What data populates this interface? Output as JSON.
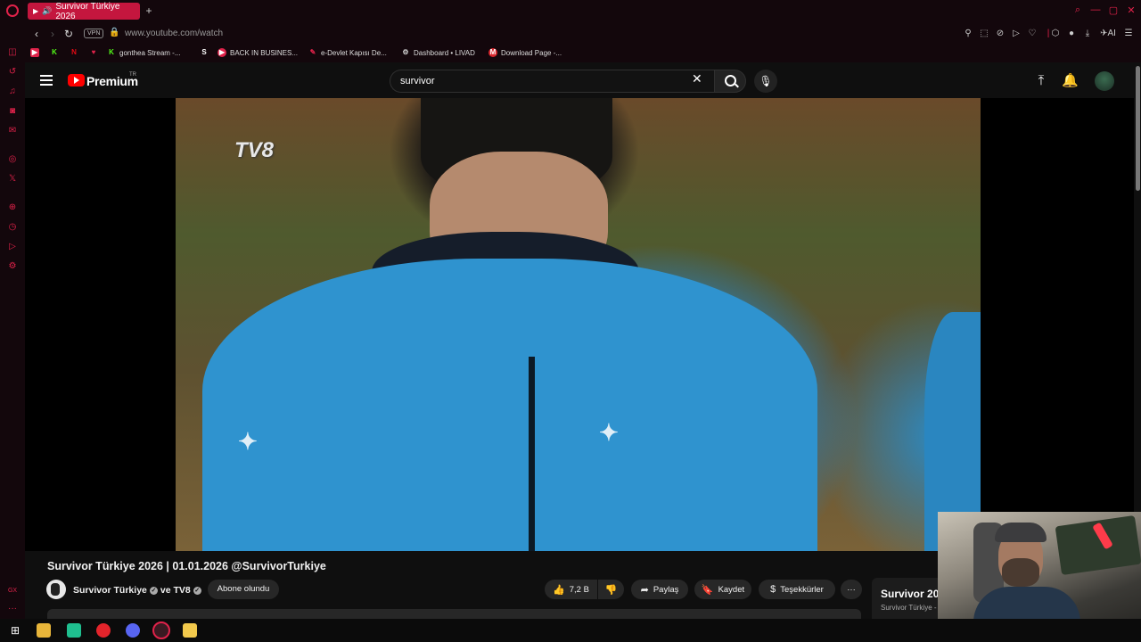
{
  "browser": {
    "tab_title": "Survivor Türkiye 2026",
    "new_tab": "+",
    "vpn_label": "VPN",
    "url": "www.youtube.com/watch",
    "ai_label": "AI"
  },
  "bookmarks": [
    {
      "label": "",
      "icon": "youtube-icon",
      "color": "#e0224a"
    },
    {
      "label": "",
      "icon": "kick-icon",
      "color": "#53fc18"
    },
    {
      "label": "",
      "icon": "netflix-icon",
      "color": "#e50914"
    },
    {
      "label": "",
      "icon": "heart-icon",
      "color": "#e0224a"
    },
    {
      "label": "gonthea Stream -...",
      "icon": "kick-icon",
      "color": "#53fc18"
    },
    {
      "label": "",
      "icon": "s-icon",
      "color": "#ffffff"
    },
    {
      "label": "BACK IN BUSINES...",
      "icon": "youtube-icon",
      "color": "#e0224a"
    },
    {
      "label": "e-Devlet Kapısı De...",
      "icon": "edevlet-icon",
      "color": "#e0224a"
    },
    {
      "label": "Dashboard • LIVAD",
      "icon": "gear-icon",
      "color": "#cccccc"
    },
    {
      "label": "Download Page -...",
      "icon": "mega-icon",
      "color": "#d9272e"
    }
  ],
  "youtube": {
    "brand": "Premium",
    "region": "TR",
    "search_value": "survivor"
  },
  "video": {
    "overlay_logo": "TV8",
    "title": "Survivor Türkiye 2026 | 01.01.2026 @SurvivorTurkiye",
    "channel": "Survivor Türkiye",
    "channel_joiner": "ve TV8",
    "subscribe_label": "Abone olundu",
    "likes": "7,2 B",
    "share_label": "Paylaş",
    "save_label": "Kaydet",
    "thanks_label": "Teşekkürler",
    "more_label": "···"
  },
  "sidebar_recommendation": {
    "title": "Survivor 20",
    "channel": "Survivor Türkiye -"
  },
  "sidebar_icons": [
    "messenger-icon",
    "history-icon",
    "music-icon",
    "whatsapp-icon",
    "mail-icon",
    "instagram-icon",
    "x-icon",
    "add-icon",
    "clock-icon",
    "pinboard-icon",
    "settings-icon"
  ],
  "sidebar_bottom": "GX",
  "colors": {
    "accent": "#e0224a",
    "tab_active": "#c4163e",
    "youtube_red": "#ff0000"
  }
}
